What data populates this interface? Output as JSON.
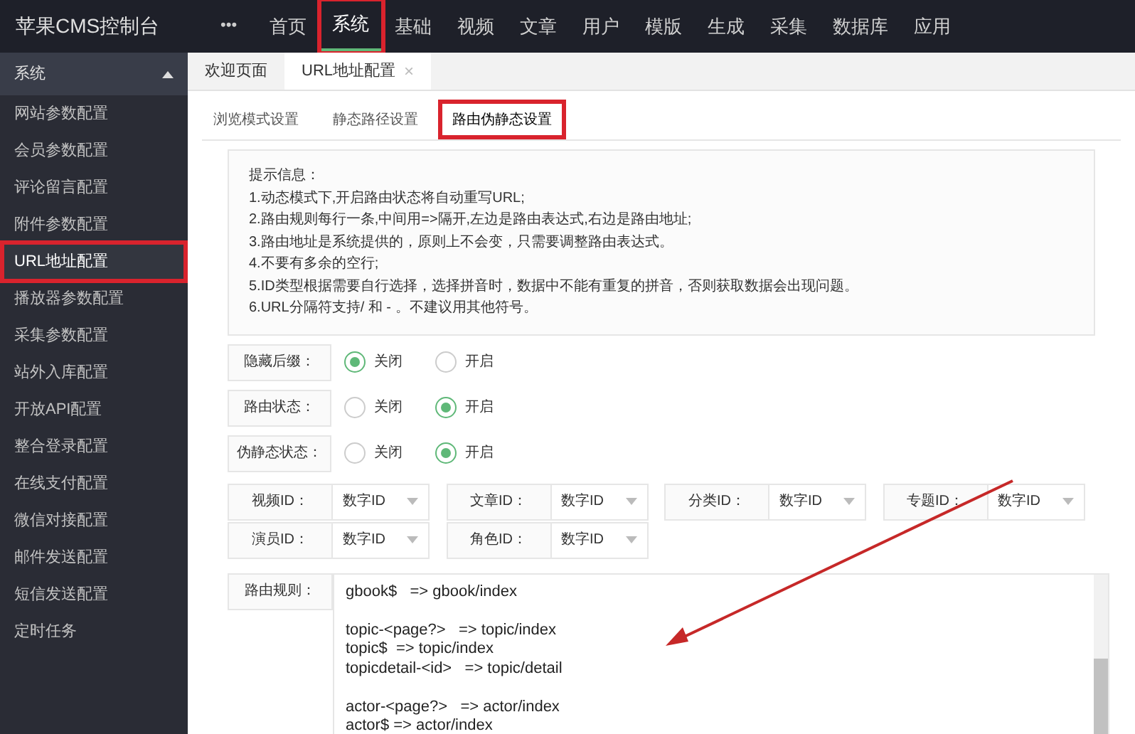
{
  "app_title": "苹果CMS控制台",
  "nav": {
    "more": "•••",
    "items": [
      {
        "label": "首页",
        "selected": false,
        "highlighted": false
      },
      {
        "label": "系统",
        "selected": true,
        "highlighted": true
      },
      {
        "label": "基础",
        "selected": false,
        "highlighted": false
      },
      {
        "label": "视频",
        "selected": false,
        "highlighted": false
      },
      {
        "label": "文章",
        "selected": false,
        "highlighted": false
      },
      {
        "label": "用户",
        "selected": false,
        "highlighted": false
      },
      {
        "label": "模版",
        "selected": false,
        "highlighted": false
      },
      {
        "label": "生成",
        "selected": false,
        "highlighted": false
      },
      {
        "label": "采集",
        "selected": false,
        "highlighted": false
      },
      {
        "label": "数据库",
        "selected": false,
        "highlighted": false
      },
      {
        "label": "应用",
        "selected": false,
        "highlighted": false
      }
    ]
  },
  "sidebar": {
    "title": "系统",
    "expanded": true,
    "items": [
      {
        "label": "网站参数配置",
        "selected": false,
        "highlighted": false
      },
      {
        "label": "会员参数配置",
        "selected": false,
        "highlighted": false
      },
      {
        "label": "评论留言配置",
        "selected": false,
        "highlighted": false
      },
      {
        "label": "附件参数配置",
        "selected": false,
        "highlighted": false
      },
      {
        "label": "URL地址配置",
        "selected": true,
        "highlighted": true
      },
      {
        "label": "播放器参数配置",
        "selected": false,
        "highlighted": false
      },
      {
        "label": "采集参数配置",
        "selected": false,
        "highlighted": false
      },
      {
        "label": "站外入库配置",
        "selected": false,
        "highlighted": false
      },
      {
        "label": "开放API配置",
        "selected": false,
        "highlighted": false
      },
      {
        "label": "整合登录配置",
        "selected": false,
        "highlighted": false
      },
      {
        "label": "在线支付配置",
        "selected": false,
        "highlighted": false
      },
      {
        "label": "微信对接配置",
        "selected": false,
        "highlighted": false
      },
      {
        "label": "邮件发送配置",
        "selected": false,
        "highlighted": false
      },
      {
        "label": "短信发送配置",
        "selected": false,
        "highlighted": false
      },
      {
        "label": "定时任务",
        "selected": false,
        "highlighted": false
      }
    ]
  },
  "page_tabs": [
    {
      "label": "欢迎页面",
      "selected": false
    },
    {
      "label": "URL地址配置",
      "selected": true,
      "close": "×"
    }
  ],
  "sub_tabs": [
    {
      "label": "浏览模式设置",
      "selected": false,
      "highlighted": false
    },
    {
      "label": "静态路径设置",
      "selected": false,
      "highlighted": false
    },
    {
      "label": "路由伪静态设置",
      "selected": true,
      "highlighted": true
    }
  ],
  "notice": [
    "提示信息：",
    "1.动态模式下,开启路由状态将自动重写URL;",
    "2.路由规则每行一条,中间用=>隔开,左边是路由表达式,右边是路由地址;",
    "3.路由地址是系统提供的，原则上不会变，只需要调整路由表达式。",
    "4.不要有多余的空行;",
    "5.ID类型根据需要自行选择，选择拼音时，数据中不能有重复的拼音，否则获取数据会出现问题。",
    "6.URL分隔符支持/ 和 - 。不建议用其他符号。"
  ],
  "switches": [
    {
      "label": "隐藏后缀：",
      "options": [
        {
          "label": "关闭",
          "selected": true
        },
        {
          "label": "开启",
          "selected": false
        }
      ]
    },
    {
      "label": "路由状态：",
      "options": [
        {
          "label": "关闭",
          "selected": false
        },
        {
          "label": "开启",
          "selected": true
        }
      ]
    },
    {
      "label": "伪静态状态：",
      "options": [
        {
          "label": "关闭",
          "selected": false
        },
        {
          "label": "开启",
          "selected": true
        }
      ]
    }
  ],
  "id_selects": [
    {
      "label": "视频ID：",
      "value": "数字ID"
    },
    {
      "label": "文章ID：",
      "value": "数字ID"
    },
    {
      "label": "分类ID：",
      "value": "数字ID"
    },
    {
      "label": "专题ID：",
      "value": "数字ID"
    },
    {
      "label": "演员ID：",
      "value": "数字ID"
    },
    {
      "label": "角色ID：",
      "value": "数字ID"
    }
  ],
  "rules": {
    "label": "路由规则：",
    "blocks": [
      [
        "gbook$   => gbook/index"
      ],
      [
        "topic-<page?>   => topic/index",
        "topic$  => topic/index",
        "topicdetail-<id>   => topic/detail"
      ],
      [
        "actor-<page?>   => actor/index",
        "actor$ => actor/index"
      ]
    ]
  }
}
